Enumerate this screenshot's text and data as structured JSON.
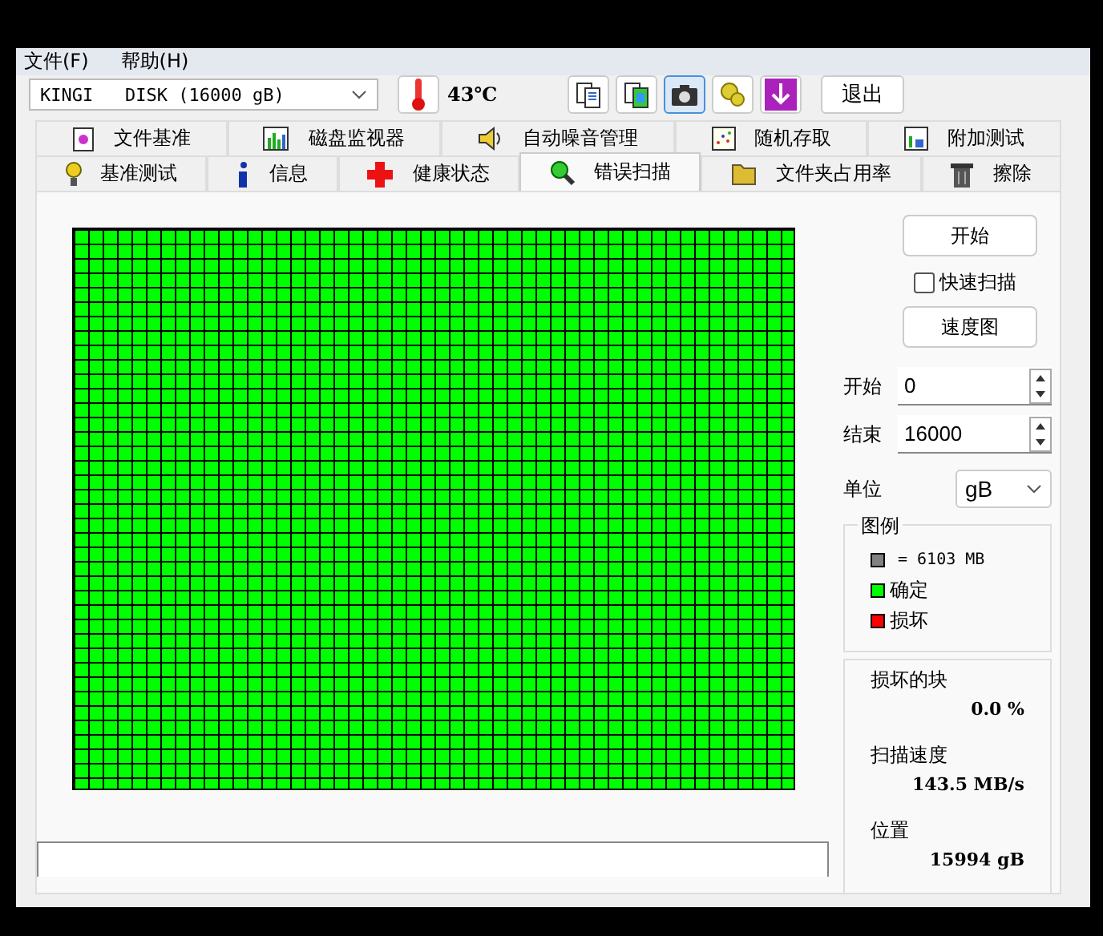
{
  "menu": [
    {
      "label": "文件(F)"
    },
    {
      "label": "帮助(H)"
    }
  ],
  "toolbar": {
    "drive": "KINGI   DISK (16000 gB)",
    "temperature": "43℃",
    "tools": [
      {
        "kind": "copy",
        "selected": false
      },
      {
        "kind": "copy-color",
        "selected": false
      },
      {
        "kind": "camera",
        "selected": true
      },
      {
        "kind": "options",
        "selected": false
      },
      {
        "kind": "download",
        "selected": false
      }
    ],
    "exit": "退出"
  },
  "tab_rows": [
    [
      {
        "label": "文件基准",
        "kind": "file",
        "selected": false
      },
      {
        "label": "磁盘监视器",
        "kind": "monitor",
        "selected": false
      },
      {
        "label": "自动噪音管理",
        "kind": "speaker",
        "selected": false
      },
      {
        "label": "随机存取",
        "kind": "scatter",
        "selected": false
      },
      {
        "label": "附加测试",
        "kind": "extra",
        "selected": false
      }
    ],
    [
      {
        "label": "基准测试",
        "kind": "bulb",
        "selected": false
      },
      {
        "label": "信息",
        "kind": "info",
        "selected": false
      },
      {
        "label": "健康状态",
        "kind": "cross",
        "selected": false
      },
      {
        "label": "错误扫描",
        "kind": "magnifier",
        "selected": true
      },
      {
        "label": "文件夹占用率",
        "kind": "folder",
        "selected": false
      },
      {
        "label": "擦除",
        "kind": "trash",
        "selected": false
      }
    ]
  ],
  "controls": {
    "start_button": "开始",
    "quick_scan": {
      "label": "快速扫描",
      "checked": false
    },
    "speed_button": "速度图",
    "start": {
      "label": "开始",
      "value": "0"
    },
    "end": {
      "label": "结束",
      "value": "16000"
    },
    "unit": {
      "label": "单位",
      "value": "gB"
    }
  },
  "legend": {
    "title": "图例",
    "items": [
      {
        "label": "= 6103 MB",
        "color": "#808080"
      },
      {
        "label": "确定",
        "color": "#00ff00"
      },
      {
        "label": "损坏",
        "color": "#ff0000"
      }
    ]
  },
  "stats": [
    {
      "label": "损坏的块",
      "value": "0.0 %"
    },
    {
      "label": "扫描速度",
      "value": "143.5 MB/s"
    },
    {
      "label": "位置",
      "value": "15994 gB"
    }
  ]
}
